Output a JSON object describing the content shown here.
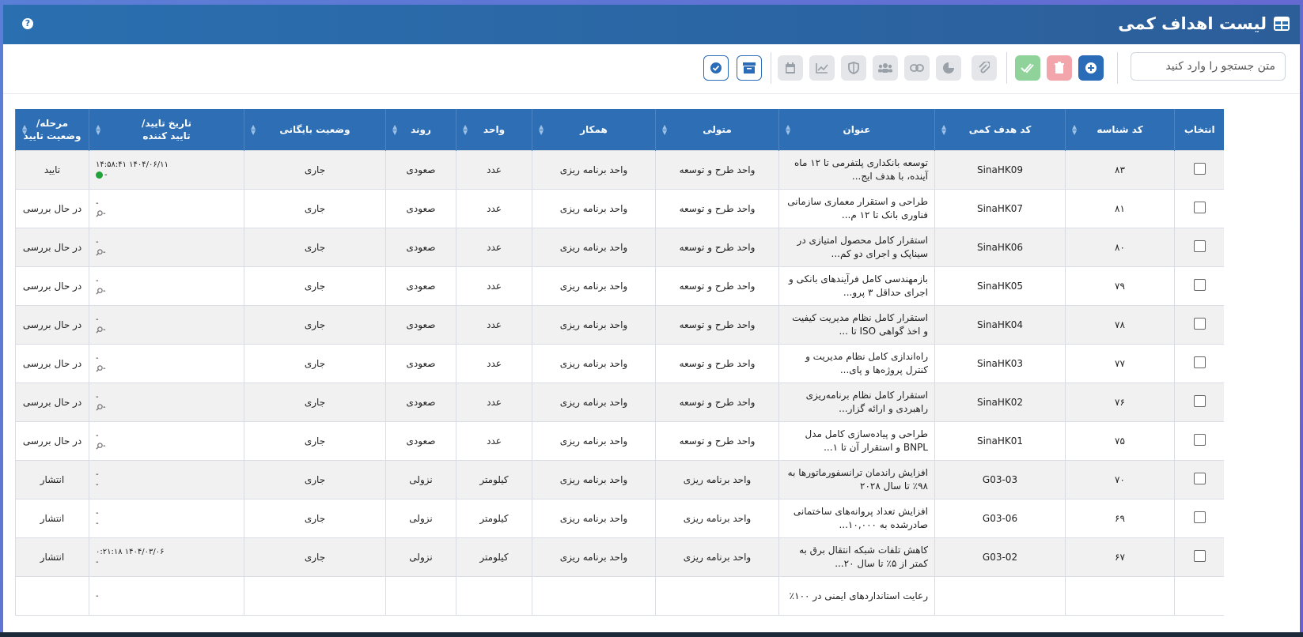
{
  "window": {
    "title": "لیست اهداف کمی",
    "help_label": "?"
  },
  "toolbar": {
    "search_placeholder": "متن جستجو را وارد کنید"
  },
  "colors": {
    "header": "#2d6eb5",
    "primary": "#2b6cb8",
    "success": "#1fa33a"
  },
  "table": {
    "headers": {
      "select": "انتخاب",
      "id_code": "کد شناسه",
      "target_code": "کد هدف کمی",
      "title": "عنوان",
      "owner": "متولی",
      "partner": "همکار",
      "unit": "واحد",
      "trend": "روند",
      "archive": "وضعیت بایگانی",
      "confirm_date_1": "تاریخ تایید/",
      "confirm_date_2": "تایید کننده",
      "stage_1": "مرحله/",
      "stage_2": "وضعیت تایید"
    },
    "rows": [
      {
        "id": "۸۳",
        "code": "SinaHK09",
        "title": "توسعه بانکداری پلتفرمی تا ۱۲ ماه آینده، با هدف ایج...",
        "owner": "واحد طرح و توسعه",
        "partner": "واحد برنامه ریزی",
        "unit": "عدد",
        "trend": "صعودی",
        "archive": "جاری",
        "date": "۱۴۰۴/۰۶/۱۱ ۱۴:۵۸:۴۱",
        "by": "-",
        "stage": "تایید",
        "icon": "check"
      },
      {
        "id": "۸۱",
        "code": "SinaHK07",
        "title": "طراحی و استقرار معماری سازمانی فناوری بانک تا ۱۲ م...",
        "owner": "واحد طرح و توسعه",
        "partner": "واحد برنامه ریزی",
        "unit": "عدد",
        "trend": "صعودی",
        "archive": "جاری",
        "date": "-",
        "by": "-",
        "stage": "در حال بررسی",
        "icon": "search"
      },
      {
        "id": "۸۰",
        "code": "SinaHK06",
        "title": "استقرار کامل محصول امتیازی در سیناپک و اجرای دو کم...",
        "owner": "واحد طرح و توسعه",
        "partner": "واحد برنامه ریزی",
        "unit": "عدد",
        "trend": "صعودی",
        "archive": "جاری",
        "date": "-",
        "by": "-",
        "stage": "در حال بررسی",
        "icon": "search"
      },
      {
        "id": "۷۹",
        "code": "SinaHK05",
        "title": "بازمهندسی کامل فرآیندهای بانکی و اجرای حداقل ۳ پرو...",
        "owner": "واحد طرح و توسعه",
        "partner": "واحد برنامه ریزی",
        "unit": "عدد",
        "trend": "صعودی",
        "archive": "جاری",
        "date": "-",
        "by": "-",
        "stage": "در حال بررسی",
        "icon": "search"
      },
      {
        "id": "۷۸",
        "code": "SinaHK04",
        "title": "استقرار کامل نظام مدیریت کیفیت و اخذ گواهی ISO تا ...",
        "owner": "واحد طرح و توسعه",
        "partner": "واحد برنامه ریزی",
        "unit": "عدد",
        "trend": "صعودی",
        "archive": "جاری",
        "date": "-",
        "by": "-",
        "stage": "در حال بررسی",
        "icon": "search"
      },
      {
        "id": "۷۷",
        "code": "SinaHK03",
        "title": "راه‌اندازی کامل نظام مدیریت و کنترل پروژه‌ها و پای...",
        "owner": "واحد طرح و توسعه",
        "partner": "واحد برنامه ریزی",
        "unit": "عدد",
        "trend": "صعودی",
        "archive": "جاری",
        "date": "-",
        "by": "-",
        "stage": "در حال بررسی",
        "icon": "search"
      },
      {
        "id": "۷۶",
        "code": "SinaHK02",
        "title": "استقرار کامل نظام برنامه‌ریزی راهبردی و ارائه گزار...",
        "owner": "واحد طرح و توسعه",
        "partner": "واحد برنامه ریزی",
        "unit": "عدد",
        "trend": "صعودی",
        "archive": "جاری",
        "date": "-",
        "by": "-",
        "stage": "در حال بررسی",
        "icon": "search"
      },
      {
        "id": "۷۵",
        "code": "SinaHK01",
        "title": "طراحی و پیاده‌سازی کامل مدل BNPL و استقرار آن تا ۱...",
        "owner": "واحد طرح و توسعه",
        "partner": "واحد برنامه ریزی",
        "unit": "عدد",
        "trend": "صعودی",
        "archive": "جاری",
        "date": "-",
        "by": "-",
        "stage": "در حال بررسی",
        "icon": "search"
      },
      {
        "id": "۷۰",
        "code": "G03-03",
        "title": "افزایش راندمان ترانسفورماتورها به ۹۸٪ تا سال ۲۰۲۸",
        "owner": "واحد برنامه ریزی",
        "partner": "واحد برنامه ریزی",
        "unit": "کیلومتر",
        "trend": "نزولی",
        "archive": "جاری",
        "date": "-",
        "by": "-",
        "stage": "انتشار",
        "icon": ""
      },
      {
        "id": "۶۹",
        "code": "G03-06",
        "title": "افزایش تعداد پروانه‌های ساختمانی صادرشده به ۱۰,۰۰۰...",
        "owner": "واحد برنامه ریزی",
        "partner": "واحد برنامه ریزی",
        "unit": "کیلومتر",
        "trend": "نزولی",
        "archive": "جاری",
        "date": "-",
        "by": "-",
        "stage": "انتشار",
        "icon": ""
      },
      {
        "id": "۶۷",
        "code": "G03-02",
        "title": "کاهش تلفات شبکه انتقال برق به کمتر از ۵٪ تا سال ۲۰...",
        "owner": "واحد برنامه ریزی",
        "partner": "واحد برنامه ریزی",
        "unit": "کیلومتر",
        "trend": "نزولی",
        "archive": "جاری",
        "date": "۱۴۰۴/۰۳/۰۶ ۰:۲۱:۱۸",
        "by": "-",
        "stage": "انتشار",
        "icon": ""
      },
      {
        "id": "",
        "code": "",
        "title": "رعایت استانداردهای ایمنی در ۱۰۰٪",
        "owner": "",
        "partner": "",
        "unit": "",
        "trend": "",
        "archive": "",
        "date": "-",
        "by": "",
        "stage": "",
        "icon": ""
      }
    ]
  }
}
